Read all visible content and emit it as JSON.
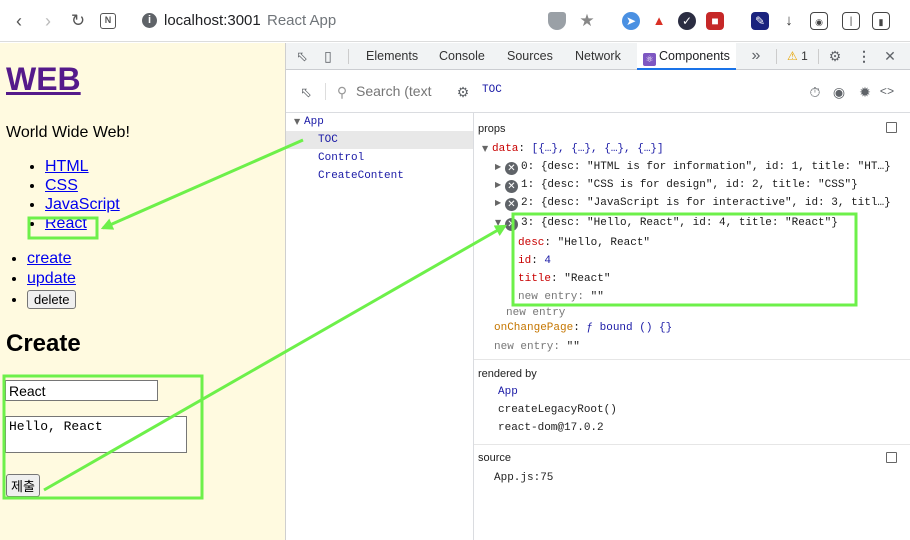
{
  "browser": {
    "host": "localhost:3001",
    "title": "React App"
  },
  "page": {
    "title": "WEB",
    "description": "World Wide Web!",
    "toc": [
      "HTML",
      "CSS",
      "JavaScript",
      "React"
    ],
    "controls": {
      "create": "create",
      "update": "update",
      "delete": "delete"
    },
    "create_heading": "Create",
    "title_input_value": "React",
    "desc_textarea_value": "Hello, React",
    "submit_label": "제출"
  },
  "devtools": {
    "tabs": [
      "Elements",
      "Console",
      "Sources",
      "Network",
      "Components"
    ],
    "active_tab": "Components",
    "warning_count": "1",
    "search_placeholder": "Search (text",
    "selected_component": "TOC",
    "tree": [
      "App",
      "TOC",
      "Control",
      "CreateContent"
    ],
    "props": {
      "heading": "props",
      "data_key": "data",
      "data_summary": "[{…}, {…}, {…}, {…}]",
      "items": [
        {
          "index": "0",
          "summary": "{desc: \"HTML is for information\", id: 1, title: \"HT…}"
        },
        {
          "index": "1",
          "summary": "{desc: \"CSS is for design\", id: 2, title: \"CSS\"}"
        },
        {
          "index": "2",
          "summary": "{desc: \"JavaScript is for interactive\", id: 3, titl…}"
        },
        {
          "index": "3",
          "summary": "{desc: \"Hello, React\", id: 4, title: \"React\"}"
        }
      ],
      "expanded": {
        "desc_key": "desc",
        "desc_val": "\"Hello, React\"",
        "id_key": "id",
        "id_val": "4",
        "title_key": "title",
        "title_val": "\"React\"",
        "new_entry_key": "new entry",
        "new_entry_val": "\"\""
      },
      "new_entry_label": "new entry",
      "onchange_key": "onChangePage",
      "onchange_val": "ƒ bound () {}",
      "new_entry2_key": "new entry",
      "new_entry2_val": "\"\""
    },
    "rendered_by": {
      "heading": "rendered by",
      "items": [
        "App",
        "createLegacyRoot()",
        "react-dom@17.0.2"
      ]
    },
    "source": {
      "heading": "source",
      "file": "App.js:75"
    }
  },
  "colors": {
    "page_bg": "#fffae0",
    "highlight": "#6df04a",
    "link": "#0000ee",
    "active_tab_accent": "#1a73e8"
  }
}
